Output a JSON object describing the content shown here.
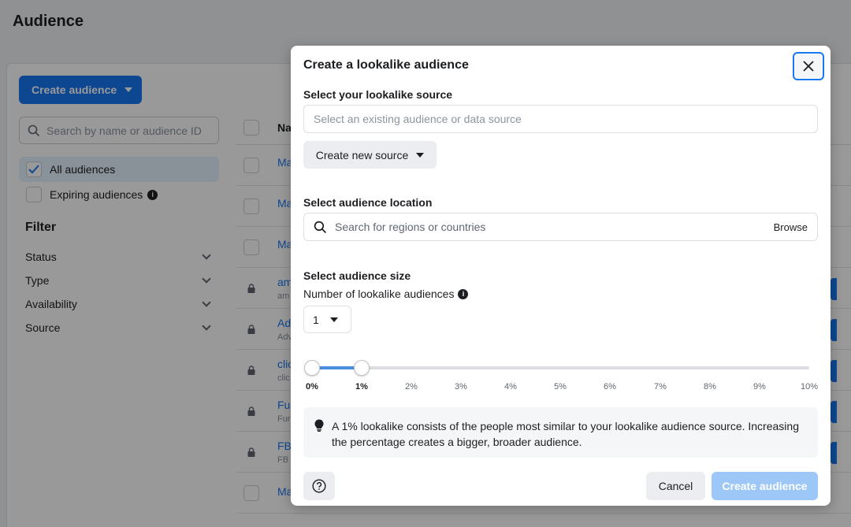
{
  "page": {
    "title": "Audience",
    "create_button_label": "Create audience",
    "search_placeholder": "Search by name or audience ID",
    "sidebar": {
      "all_audiences": "All audiences",
      "expiring_audiences": "Expiring audiences",
      "filter_title": "Filter",
      "filters": [
        "Status",
        "Type",
        "Availability",
        "Source"
      ]
    },
    "table": {
      "header_name": "Na",
      "rows": [
        {
          "name": "Ma",
          "sub": ""
        },
        {
          "name": "Ma",
          "sub": ""
        },
        {
          "name": "Ma",
          "sub": ""
        },
        {
          "name": "am",
          "sub": "am"
        },
        {
          "name": "Ad",
          "sub": "Adv"
        },
        {
          "name": "clic",
          "sub": "clic"
        },
        {
          "name": "Fu",
          "sub": "Fur"
        },
        {
          "name": "FB",
          "sub": "FB"
        },
        {
          "name": "Ma",
          "sub": ""
        }
      ]
    }
  },
  "modal": {
    "title": "Create a lookalike audience",
    "source_label": "Select your lookalike source",
    "source_placeholder": "Select an existing audience or data source",
    "create_source_label": "Create new source",
    "location_label": "Select audience location",
    "location_placeholder": "Search for regions or countries",
    "browse_label": "Browse",
    "size_label": "Select audience size",
    "number_label": "Number of lookalike audiences",
    "number_value": "1",
    "slider": {
      "range_start_percent": 0,
      "range_end_percent": 1,
      "ticks": [
        "0%",
        "1%",
        "2%",
        "3%",
        "4%",
        "5%",
        "6%",
        "7%",
        "8%",
        "9%",
        "10%"
      ]
    },
    "tip_text": "A 1% lookalike consists of the people most similar to your lookalike audience source. Increasing the percentage creates a bigger, broader audience.",
    "cancel_label": "Cancel",
    "submit_label": "Create audience"
  },
  "colors": {
    "accent": "#1877f2",
    "disabled_primary": "#9cc7f7",
    "overlay": "rgba(0,0,0,0.4)"
  }
}
